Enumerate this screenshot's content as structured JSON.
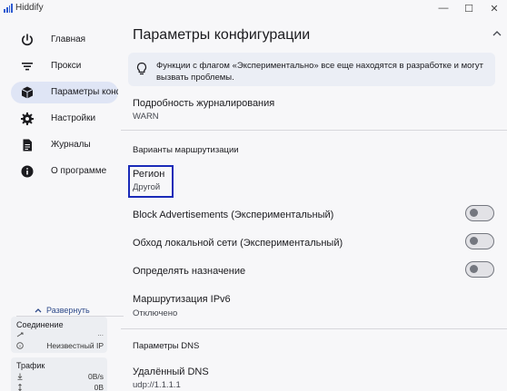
{
  "window": {
    "title": "Hiddify",
    "minimize_glyph": "—",
    "maximize_glyph": "☐",
    "close_glyph": "✕"
  },
  "colors": {
    "accent": "#2e5bd1",
    "active_nav_bg": "#dfe5f5",
    "focus_outline": "#1a2ab8"
  },
  "sidebar": {
    "items": [
      {
        "label": "Главная",
        "icon": "power-icon",
        "active": false
      },
      {
        "label": "Прокси",
        "icon": "filter-list-icon",
        "active": false
      },
      {
        "label": "Параметры конфи",
        "icon": "cube-icon",
        "active": true
      },
      {
        "label": "Настройки",
        "icon": "gear-icon",
        "active": false
      },
      {
        "label": "Журналы",
        "icon": "document-icon",
        "active": false
      },
      {
        "label": "О программе",
        "icon": "info-icon",
        "active": false
      }
    ],
    "expand_label": "Развернуть",
    "connection": {
      "title": "Соединение",
      "row1_value": "...",
      "row2_value": "Неизвестный IP"
    },
    "traffic": {
      "title": "Трафик",
      "download_value": "0B/s",
      "upload_value": "0B"
    }
  },
  "main": {
    "title": "Параметры конфигурации",
    "info_banner": "Функции с флагом «Экспериментально» все еще находятся в разработке и могут вызвать проблемы.",
    "log_level": {
      "title": "Подробность журналирования",
      "value": "WARN"
    },
    "routing_section": "Варианты маршрутизации",
    "region": {
      "title": "Регион",
      "value": "Другой"
    },
    "toggles": [
      {
        "label": "Block Advertisements (Экспериментальный)",
        "on": false
      },
      {
        "label": "Обход локальной сети (Экспериментальный)",
        "on": false
      },
      {
        "label": "Определять назначение",
        "on": false
      }
    ],
    "ipv6": {
      "title": "Маршрутизация IPv6",
      "value": "Отключено"
    },
    "dns_section": "Параметры DNS",
    "remote_dns": {
      "title": "Удалённый DNS",
      "value": "udp://1.1.1.1"
    }
  }
}
